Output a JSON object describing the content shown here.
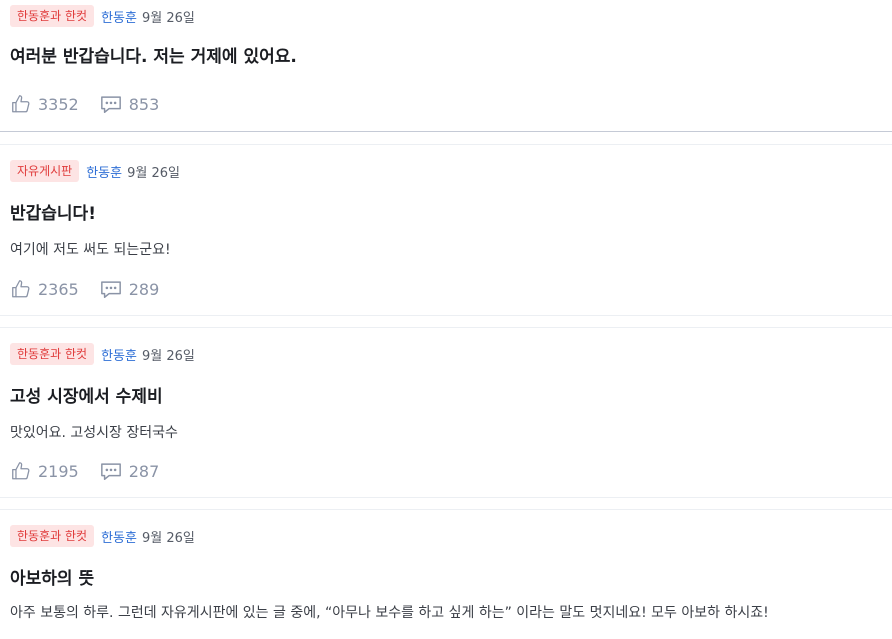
{
  "posts": [
    {
      "category": "한동훈과 한컷",
      "author": "한동훈",
      "date": "9월 26일",
      "title": "여러분 반갑습니다. 저는 거제에 있어요.",
      "body": "",
      "likes": "3352",
      "comments": "853"
    },
    {
      "category": "자유게시판",
      "author": "한동훈",
      "date": "9월 26일",
      "title": "반갑습니다!",
      "body": "여기에 저도 써도 되는군요!",
      "likes": "2365",
      "comments": "289"
    },
    {
      "category": "한동훈과 한컷",
      "author": "한동훈",
      "date": "9월 26일",
      "title": "고성 시장에서 수제비",
      "body": "맛있어요. 고성시장 장터국수",
      "likes": "2195",
      "comments": "287"
    },
    {
      "category": "한동훈과 한컷",
      "author": "한동훈",
      "date": "9월 26일",
      "title": "아보하의 뜻",
      "body": "아주 보통의 하루. 그런데 자유게시판에 있는 글 중에, “아무나 보수를 하고 싶게 하는” 이라는 말도 멋지네요! 모두 아보하 하시죠!",
      "likes": "",
      "comments": ""
    }
  ],
  "icons": {
    "like": "thumbs-up-icon",
    "comment": "comment-bubble-icon"
  },
  "colors": {
    "badge_bg": "#fde4e4",
    "badge_text": "#e03b3b",
    "author": "#2f6fd6",
    "stat": "#8a93a6"
  }
}
